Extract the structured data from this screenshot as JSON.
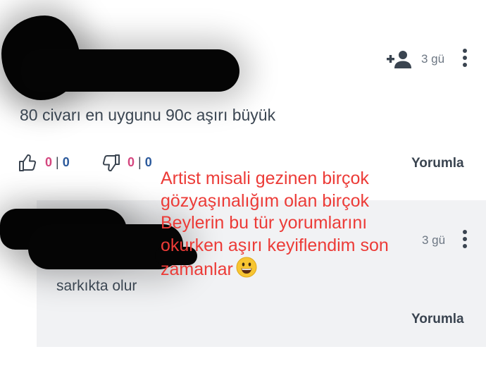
{
  "comments": [
    {
      "time": "3 gü",
      "text": "80 civarı en uygunu 90c aşırı büyük",
      "likes": "0",
      "likes_secondary": "0",
      "dislikes": "0",
      "dislikes_secondary": "0",
      "separator": "|",
      "reply_label": "Yorumla"
    },
    {
      "time": "3 gü",
      "text": "sarkıkta olur",
      "reply_label": "Yorumla"
    }
  ],
  "overlay": {
    "lines": [
      "Artist misali gezinen birçok",
      "gözyaşınalığım olan birçok",
      "Beylerin bu tür yorumlarını",
      "okurken aşırı keyiflendim son",
      "zamanlar"
    ],
    "emoji": "grinning-face-emoji",
    "color": "#ec3b37"
  },
  "icons": {
    "add_user": "add-user-icon",
    "more": "more-vertical-icon",
    "like": "thumbs-up-icon",
    "dislike": "thumbs-down-icon"
  },
  "colors": {
    "like_count": "#d4477f",
    "secondary_count": "#2c5a9c",
    "text": "#3b4652"
  }
}
